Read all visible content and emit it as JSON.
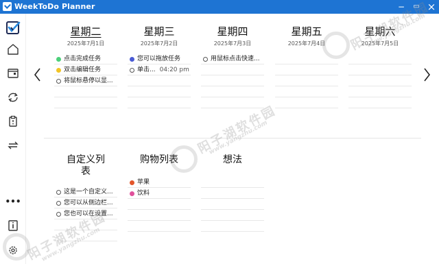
{
  "window": {
    "title": "WeekToDo Planner",
    "minimize": "−",
    "maximize": "▭",
    "close": "×"
  },
  "sidebar": {
    "items": [
      {
        "name": "app-logo-icon"
      },
      {
        "name": "home-icon"
      },
      {
        "name": "calendar-icon"
      },
      {
        "name": "sync-icon"
      },
      {
        "name": "clipboard-icon"
      },
      {
        "name": "swap-icon"
      },
      {
        "name": "more-icon",
        "label": "•••"
      },
      {
        "name": "info-icon"
      },
      {
        "name": "settings-icon"
      }
    ]
  },
  "week": {
    "days": [
      {
        "title": "星期二",
        "date": "2025年7月1日",
        "today": true,
        "tasks": [
          {
            "text": "点击完成任务",
            "dot": "#4cd07a"
          },
          {
            "text": "双击编辑任务",
            "dot": "#f2c425"
          },
          {
            "text": "将鼠标悬停以显...",
            "dot": "empty"
          }
        ]
      },
      {
        "title": "星期三",
        "date": "2025年7月2日",
        "today": false,
        "tasks": [
          {
            "text": "您可以拖放任务",
            "dot": "#4a5bd4"
          },
          {
            "text": "单击...",
            "dot": "empty",
            "time": "04:20 pm"
          }
        ]
      },
      {
        "title": "星期四",
        "date": "2025年7月3日",
        "today": false,
        "tasks": [
          {
            "text": "用鼠标点击快速...",
            "dot": "empty"
          }
        ]
      },
      {
        "title": "星期五",
        "date": "2025年7月4日",
        "today": false,
        "tasks": []
      },
      {
        "title": "星期六",
        "date": "2025年7月5日",
        "today": false,
        "tasks": []
      }
    ]
  },
  "lists": [
    {
      "title_line1": "自定义列",
      "title_line2": "表",
      "items": [
        {
          "text": "这是一个自定义...",
          "dot": "empty"
        },
        {
          "text": "您可以从侧边栏...",
          "dot": "empty"
        },
        {
          "text": "您也可以在设置...",
          "dot": "empty"
        }
      ]
    },
    {
      "title_line1": "购物列表",
      "title_line2": "",
      "items": [
        {
          "text": "苹果",
          "dot": "#e3562b"
        },
        {
          "text": "饮料",
          "dot": "#e0509b"
        }
      ]
    },
    {
      "title_line1": "想法",
      "title_line2": "",
      "items": []
    }
  ],
  "watermarks": {
    "brand": "阳子湖软件园",
    "url": "www.yangzhu.com"
  }
}
